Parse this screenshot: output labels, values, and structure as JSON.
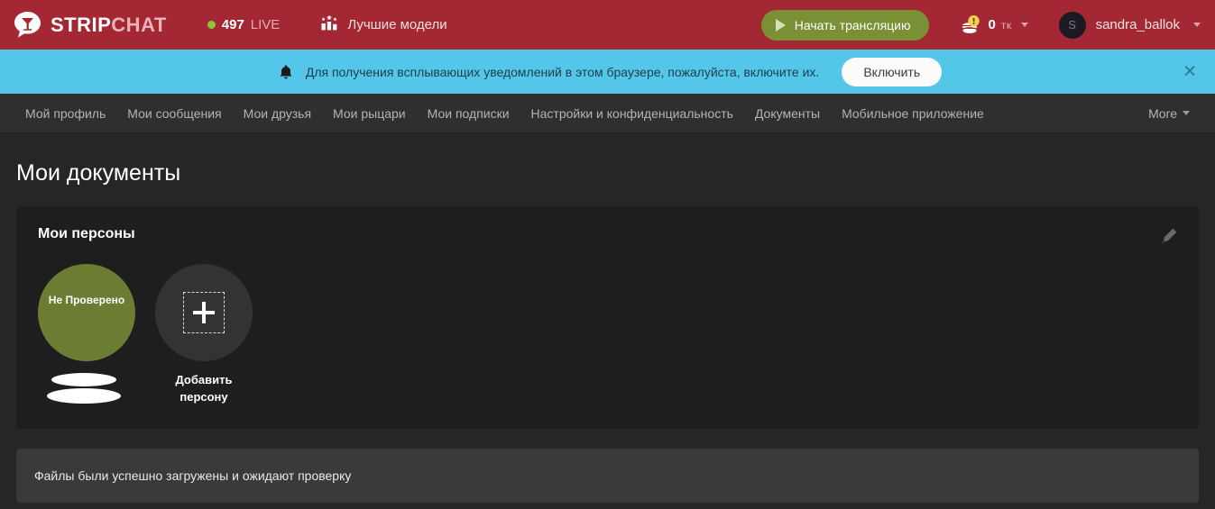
{
  "header": {
    "logo": {
      "name_bold": "STRIP",
      "name_light": "CHAT",
      "icon": "speech-bubble-cocktail-logo"
    },
    "live": {
      "count": "497",
      "label": "LIVE",
      "dot_color": "#8cc63f"
    },
    "top_models": {
      "label": "Лучшие модели",
      "icon": "podium-stars-icon"
    },
    "broadcast_button": {
      "label": "Начать трансляцию",
      "icon": "play-icon",
      "color": "#7a9035"
    },
    "tokens": {
      "count": "0",
      "unit": "тк",
      "icon": "coins-alert-icon",
      "caret": "chevron-down-icon"
    },
    "user": {
      "avatar_letter": "S",
      "username": "sandra_ballok",
      "caret": "chevron-down-icon"
    },
    "bar_color": "#a42833"
  },
  "notification": {
    "icon": "bell-icon",
    "text": "Для получения всплывающих уведомлений в этом браузере, пожалуйста, включите их.",
    "button_label": "Включить",
    "close_icon": "close-icon",
    "bar_color": "#54c6ea"
  },
  "subnav": {
    "items": [
      {
        "label": "Мой профиль",
        "name": "my-profile"
      },
      {
        "label": "Мои сообщения",
        "name": "my-messages"
      },
      {
        "label": "Мои друзья",
        "name": "my-friends"
      },
      {
        "label": "Мои рыцари",
        "name": "my-knights"
      },
      {
        "label": "Мои подписки",
        "name": "my-subscriptions"
      },
      {
        "label": "Настройки и конфиденциальность",
        "name": "settings-privacy"
      },
      {
        "label": "Документы",
        "name": "documents"
      },
      {
        "label": "Мобильное приложение",
        "name": "mobile-app"
      }
    ],
    "more_label": "More"
  },
  "main": {
    "page_title": "Мои документы",
    "card": {
      "title": "Мои персоны",
      "edit_icon": "pencil-edit-icon",
      "personas": [
        {
          "status_label": "Не Проверено",
          "name_redacted": true,
          "circle_color": "#6b7c33",
          "element_name": "persona-unverified"
        }
      ],
      "add_persona_label": "Добавить персону"
    },
    "status_message": "Файлы были успешно загружены и ожидают проверку"
  }
}
